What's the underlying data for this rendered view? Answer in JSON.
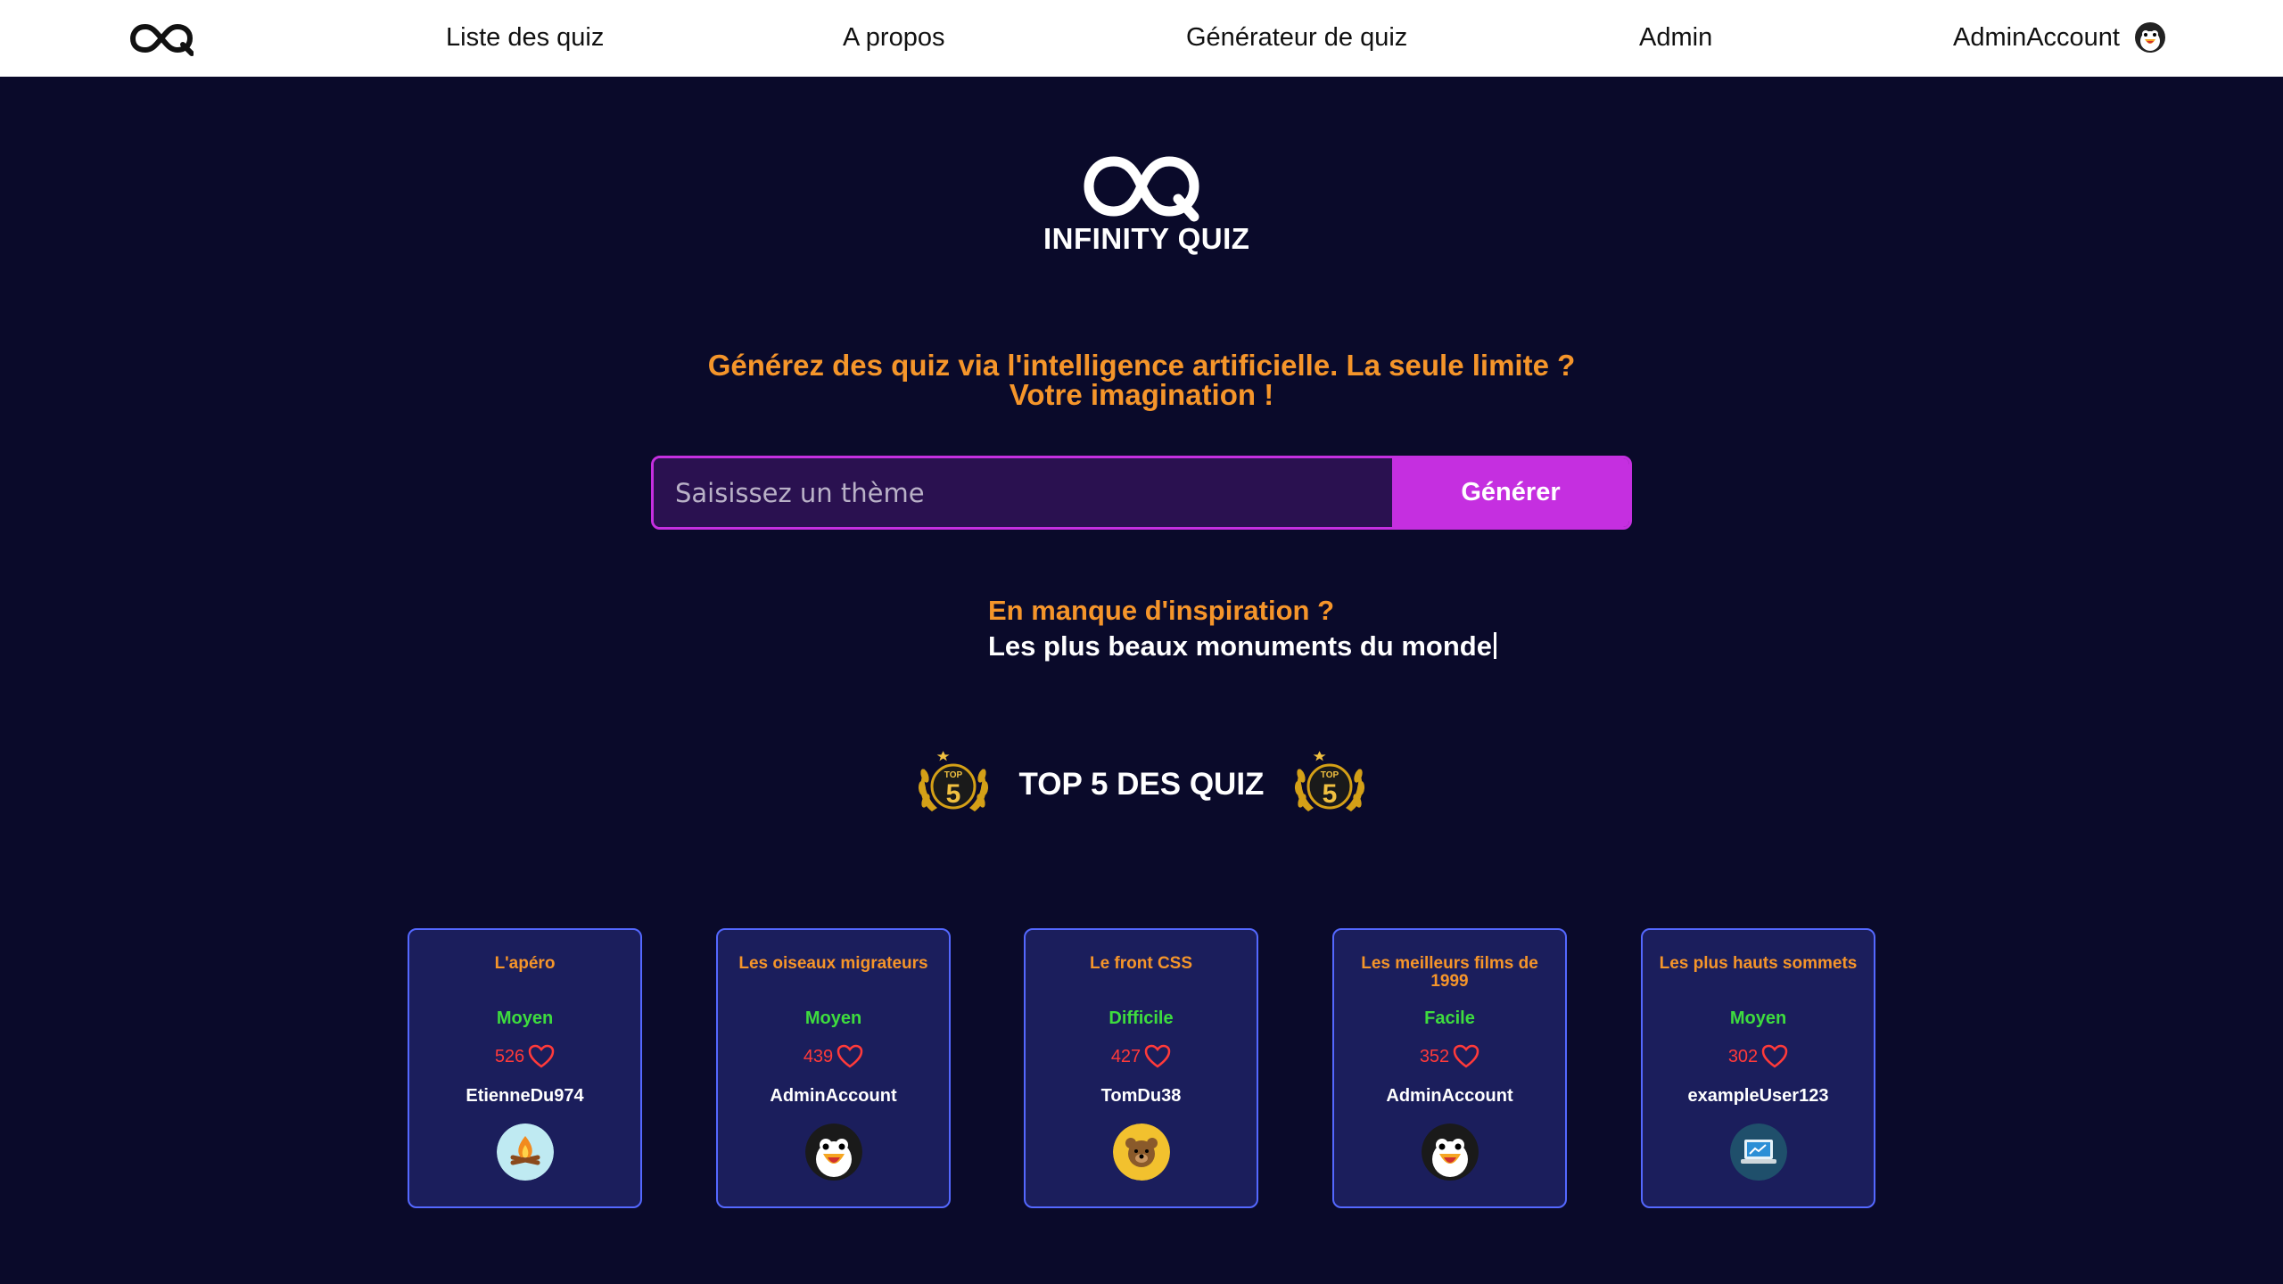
{
  "nav": {
    "items": [
      "Liste des quiz",
      "A propos",
      "Générateur de quiz",
      "Admin"
    ],
    "account": "AdminAccount"
  },
  "hero": {
    "brand": "INFINITY QUIZ",
    "tagline_line1": "Générez des quiz via l'intelligence artificielle. La seule limite ?",
    "tagline_line2": "Votre imagination !"
  },
  "search": {
    "placeholder": "Saisissez un thème",
    "button": "Générer"
  },
  "inspiration": {
    "title": "En manque d'inspiration ?",
    "text": "Les plus beaux monuments du monde"
  },
  "top5": {
    "title": "TOP 5 DES QUIZ",
    "badge_text": "TOP",
    "badge_number": "5"
  },
  "cards": [
    {
      "title": "L'apéro",
      "level": "Moyen",
      "likes": "526",
      "author": "EtienneDu974",
      "avatar": "campfire-avatar"
    },
    {
      "title": "Les oiseaux migrateurs",
      "level": "Moyen",
      "likes": "439",
      "author": "AdminAccount",
      "avatar": "penguin-avatar"
    },
    {
      "title": "Le front CSS",
      "level": "Difficile",
      "likes": "427",
      "author": "TomDu38",
      "avatar": "bear-avatar"
    },
    {
      "title": "Les meilleurs films de 1999",
      "level": "Facile",
      "likes": "352",
      "author": "AdminAccount",
      "avatar": "penguin-avatar"
    },
    {
      "title": "Les plus hauts sommets",
      "level": "Moyen",
      "likes": "302",
      "author": "exampleUser123",
      "avatar": "laptop-avatar"
    }
  ],
  "colors": {
    "background": "#0a0a2a",
    "accent_orange": "#f5952a",
    "accent_purple": "#c52fe0",
    "card_bg": "#1b1e5c",
    "card_border": "#5468ff",
    "level_green": "#3edc3e",
    "likes_red": "#ff3a3a"
  }
}
